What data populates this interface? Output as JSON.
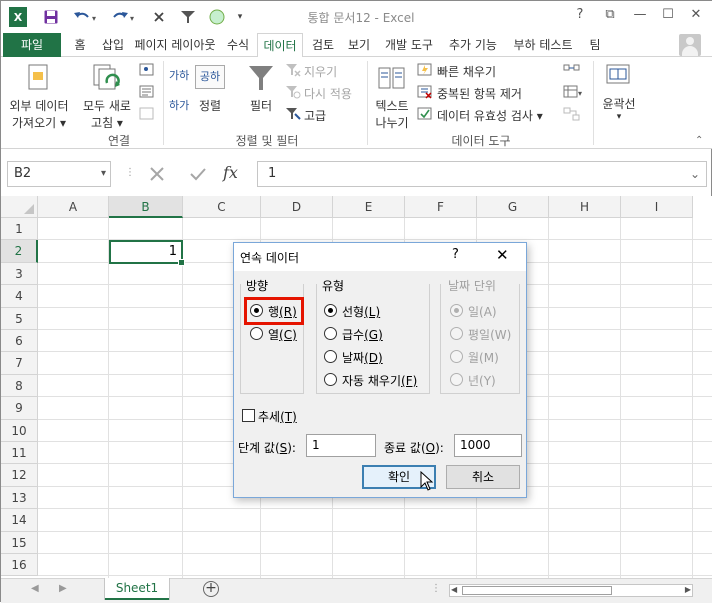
{
  "titlebar": {
    "title": "통합 문서12 - Excel",
    "app_icon_label": "X",
    "help_label": "?",
    "ribbon_options_label": "⧉",
    "minimize_label": "—",
    "restore_label": "☐",
    "close_label": "✕"
  },
  "tabs": {
    "file": "파일",
    "items": [
      "홈",
      "삽입",
      "페이지 레이아웃",
      "수식",
      "데이터",
      "검토",
      "보기",
      "개발 도구",
      "추가 기능",
      "부하 테스트",
      "팀"
    ],
    "active": "데이터"
  },
  "ribbon": {
    "external_data": [
      "외부 데이터",
      "가져오기 ▾"
    ],
    "refresh_all": [
      "모두 새로",
      "고침 ▾"
    ],
    "connections_group": "연결",
    "sort": "정렬",
    "filter": "필터",
    "clear": "지우기",
    "reapply": "다시 적용",
    "advanced": "고급",
    "sort_filter_group": "정렬 및 필터",
    "text_to_columns": [
      "텍스트",
      "나누기"
    ],
    "flash_fill": "빠른 채우기",
    "remove_duplicates": "중복된 항목 제거",
    "data_validation": "데이터 유효성 검사 ▾",
    "data_tools_group": "데이터 도구",
    "outline": [
      "윤곽선",
      "▾"
    ],
    "sort_az_label": "가하",
    "sort_za_label": "하가",
    "sort_icon_label": "공하"
  },
  "formula_bar": {
    "name_box": "B2",
    "name_box_arrow": "▾",
    "separator": "⋮",
    "fx_label": "fx",
    "value": "1",
    "expand_arrow": "⌄"
  },
  "grid": {
    "columns": [
      "A",
      "B",
      "C",
      "D",
      "E",
      "F",
      "G",
      "H",
      "I"
    ],
    "rows": [
      "1",
      "2",
      "3",
      "4",
      "5",
      "6",
      "7",
      "8",
      "9",
      "10",
      "11",
      "12",
      "13",
      "14",
      "15",
      "16"
    ],
    "selected_cell_value": "1"
  },
  "sheets": {
    "active": "Sheet1",
    "add_label": "+",
    "nav_prev": "◀",
    "nav_next": "▶",
    "scroll_left": "◀",
    "scroll_right": "▶"
  },
  "dialog": {
    "title": "연속 데이터",
    "help": "?",
    "close": "✕",
    "direction": {
      "label": "방향",
      "row_label": "행",
      "row_key": "(R)",
      "column_label": "열",
      "column_key": "(C)"
    },
    "type": {
      "label": "유형",
      "linear": "선형",
      "linear_key": "(L)",
      "growth": "급수",
      "growth_key": "(G)",
      "date": "날짜",
      "date_key": "(D)",
      "autofill": "자동 채우기",
      "autofill_key": "(F)"
    },
    "date_unit": {
      "label": "날짜 단위",
      "day": "일(A)",
      "weekday": "평일(W)",
      "month": "월(M)",
      "year": "년(Y)"
    },
    "trend": "추세",
    "trend_key": "(T)",
    "step_label": "단계 값",
    "step_key": "(S):",
    "step_value": "1",
    "stop_label": "종료 값",
    "stop_key": "(O):",
    "stop_value": "1000",
    "ok": "확인",
    "cancel": "취소"
  },
  "colors": {
    "accent": "#217346",
    "highlight": "#e51400"
  }
}
